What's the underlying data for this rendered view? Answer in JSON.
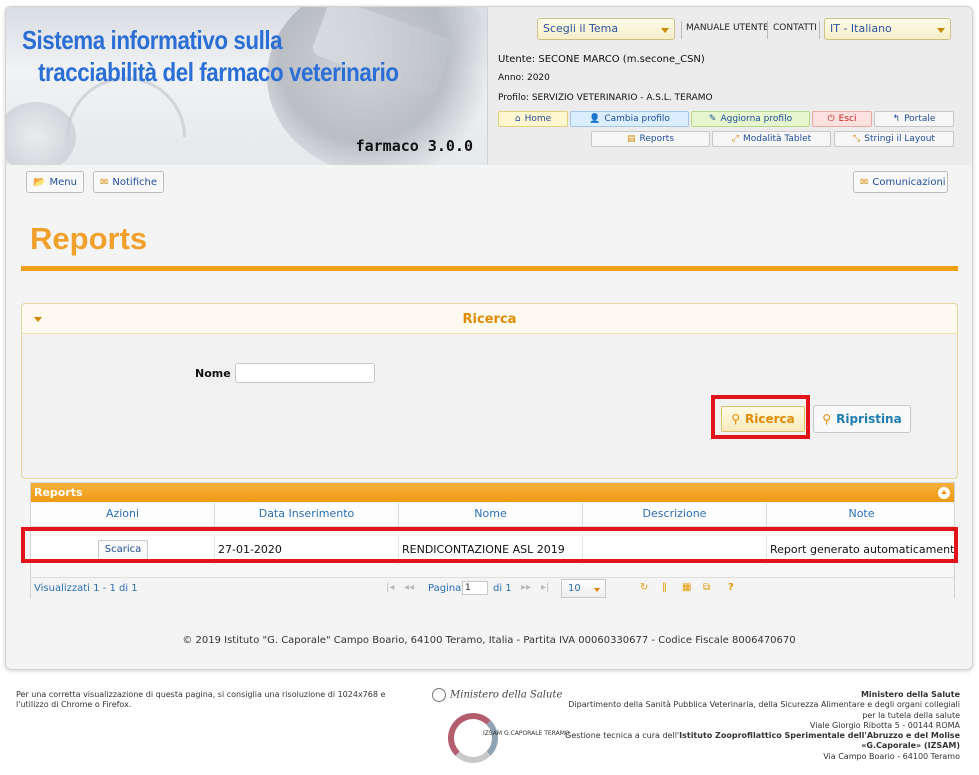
{
  "header": {
    "title_line1": "Sistema informativo sulla",
    "title_line2": "tracciabilità del farmaco veterinario",
    "version": "farmaco 3.0.0",
    "theme_select": "Scegli il Tema",
    "manual_link": "MANUALE UTENTE",
    "contacts_link": "CONTATTI",
    "language_select": "IT - Italiano",
    "user_line": "Utente: SECONE MARCO (m.secone_CSN)",
    "year_line": "Anno: 2020",
    "profile_line": "Profilo: SERVIZIO VETERINARIO - A.S.L. TERAMO",
    "buttons": {
      "home": "Home",
      "change_profile": "Cambia profilo",
      "update_profile": "Aggiorna profilo",
      "exit": "Esci",
      "portal": "Portale",
      "reports": "Reports",
      "tablet_mode": "Modalità Tablet",
      "shrink_layout": "Stringi il Layout"
    }
  },
  "toolbar": {
    "menu": "Menu",
    "notifications": "Notifiche",
    "communications": "Comunicazioni"
  },
  "page": {
    "title": "Reports"
  },
  "search": {
    "panel_title": "Ricerca",
    "name_label": "Nome",
    "name_value": "",
    "search_button": "Ricerca",
    "reset_button": "Ripristina"
  },
  "grid": {
    "caption": "Reports",
    "columns": [
      "Azioni",
      "Data Inserimento",
      "Nome",
      "Descrizione",
      "Note"
    ],
    "rows": [
      {
        "action": "Scarica",
        "date": "27-01-2020",
        "name": "RENDICONTAZIONE ASL 2019",
        "description": "",
        "note": "Report generato automaticamente. N"
      }
    ],
    "pager": {
      "visible": "Visualizzati 1 - 1 di 1",
      "page_label": "Pagina",
      "page_value": "1",
      "of_label": "di 1",
      "rows_per_page": "10"
    }
  },
  "footer": {
    "copyright": "© 2019 Istituto \"G. Caporale\" Campo Boario, 64100 Teramo, Italia - Partita IVA 00060330677 - Codice Fiscale 8006470670",
    "browser_note": "Per una corretta visualizzazione di questa pagina, si consiglia una risoluzione di 1024x768 e l'utilizzo di Chrome o Firefox.",
    "ministry_logo_text": "Ministero della Salute",
    "izs_logo_text": "IZSAM G.CAPORALE TERAMO",
    "ministry_name": "Ministero della Salute",
    "ministry_dept": "Dipartimento della Sanità Pubblica Veterinaria, della Sicurezza Alimentare e degli organi collegiali per la tutela della salute",
    "ministry_address": "Viale Giorgio Ribotta 5 - 00144 ROMA",
    "tech_prefix": "Gestione tecnica a cura dell'",
    "tech_institute": "Istituto Zooprofilattico Sperimentale dell'Abruzzo e del Molise «G.Caporale» (IZSAM)",
    "tech_address": "Via Campo Boario - 64100 Teramo"
  },
  "colors": {
    "accent_orange": "#f0a02b",
    "link_blue": "#2a6fb3",
    "highlight_red": "#e3131b"
  }
}
